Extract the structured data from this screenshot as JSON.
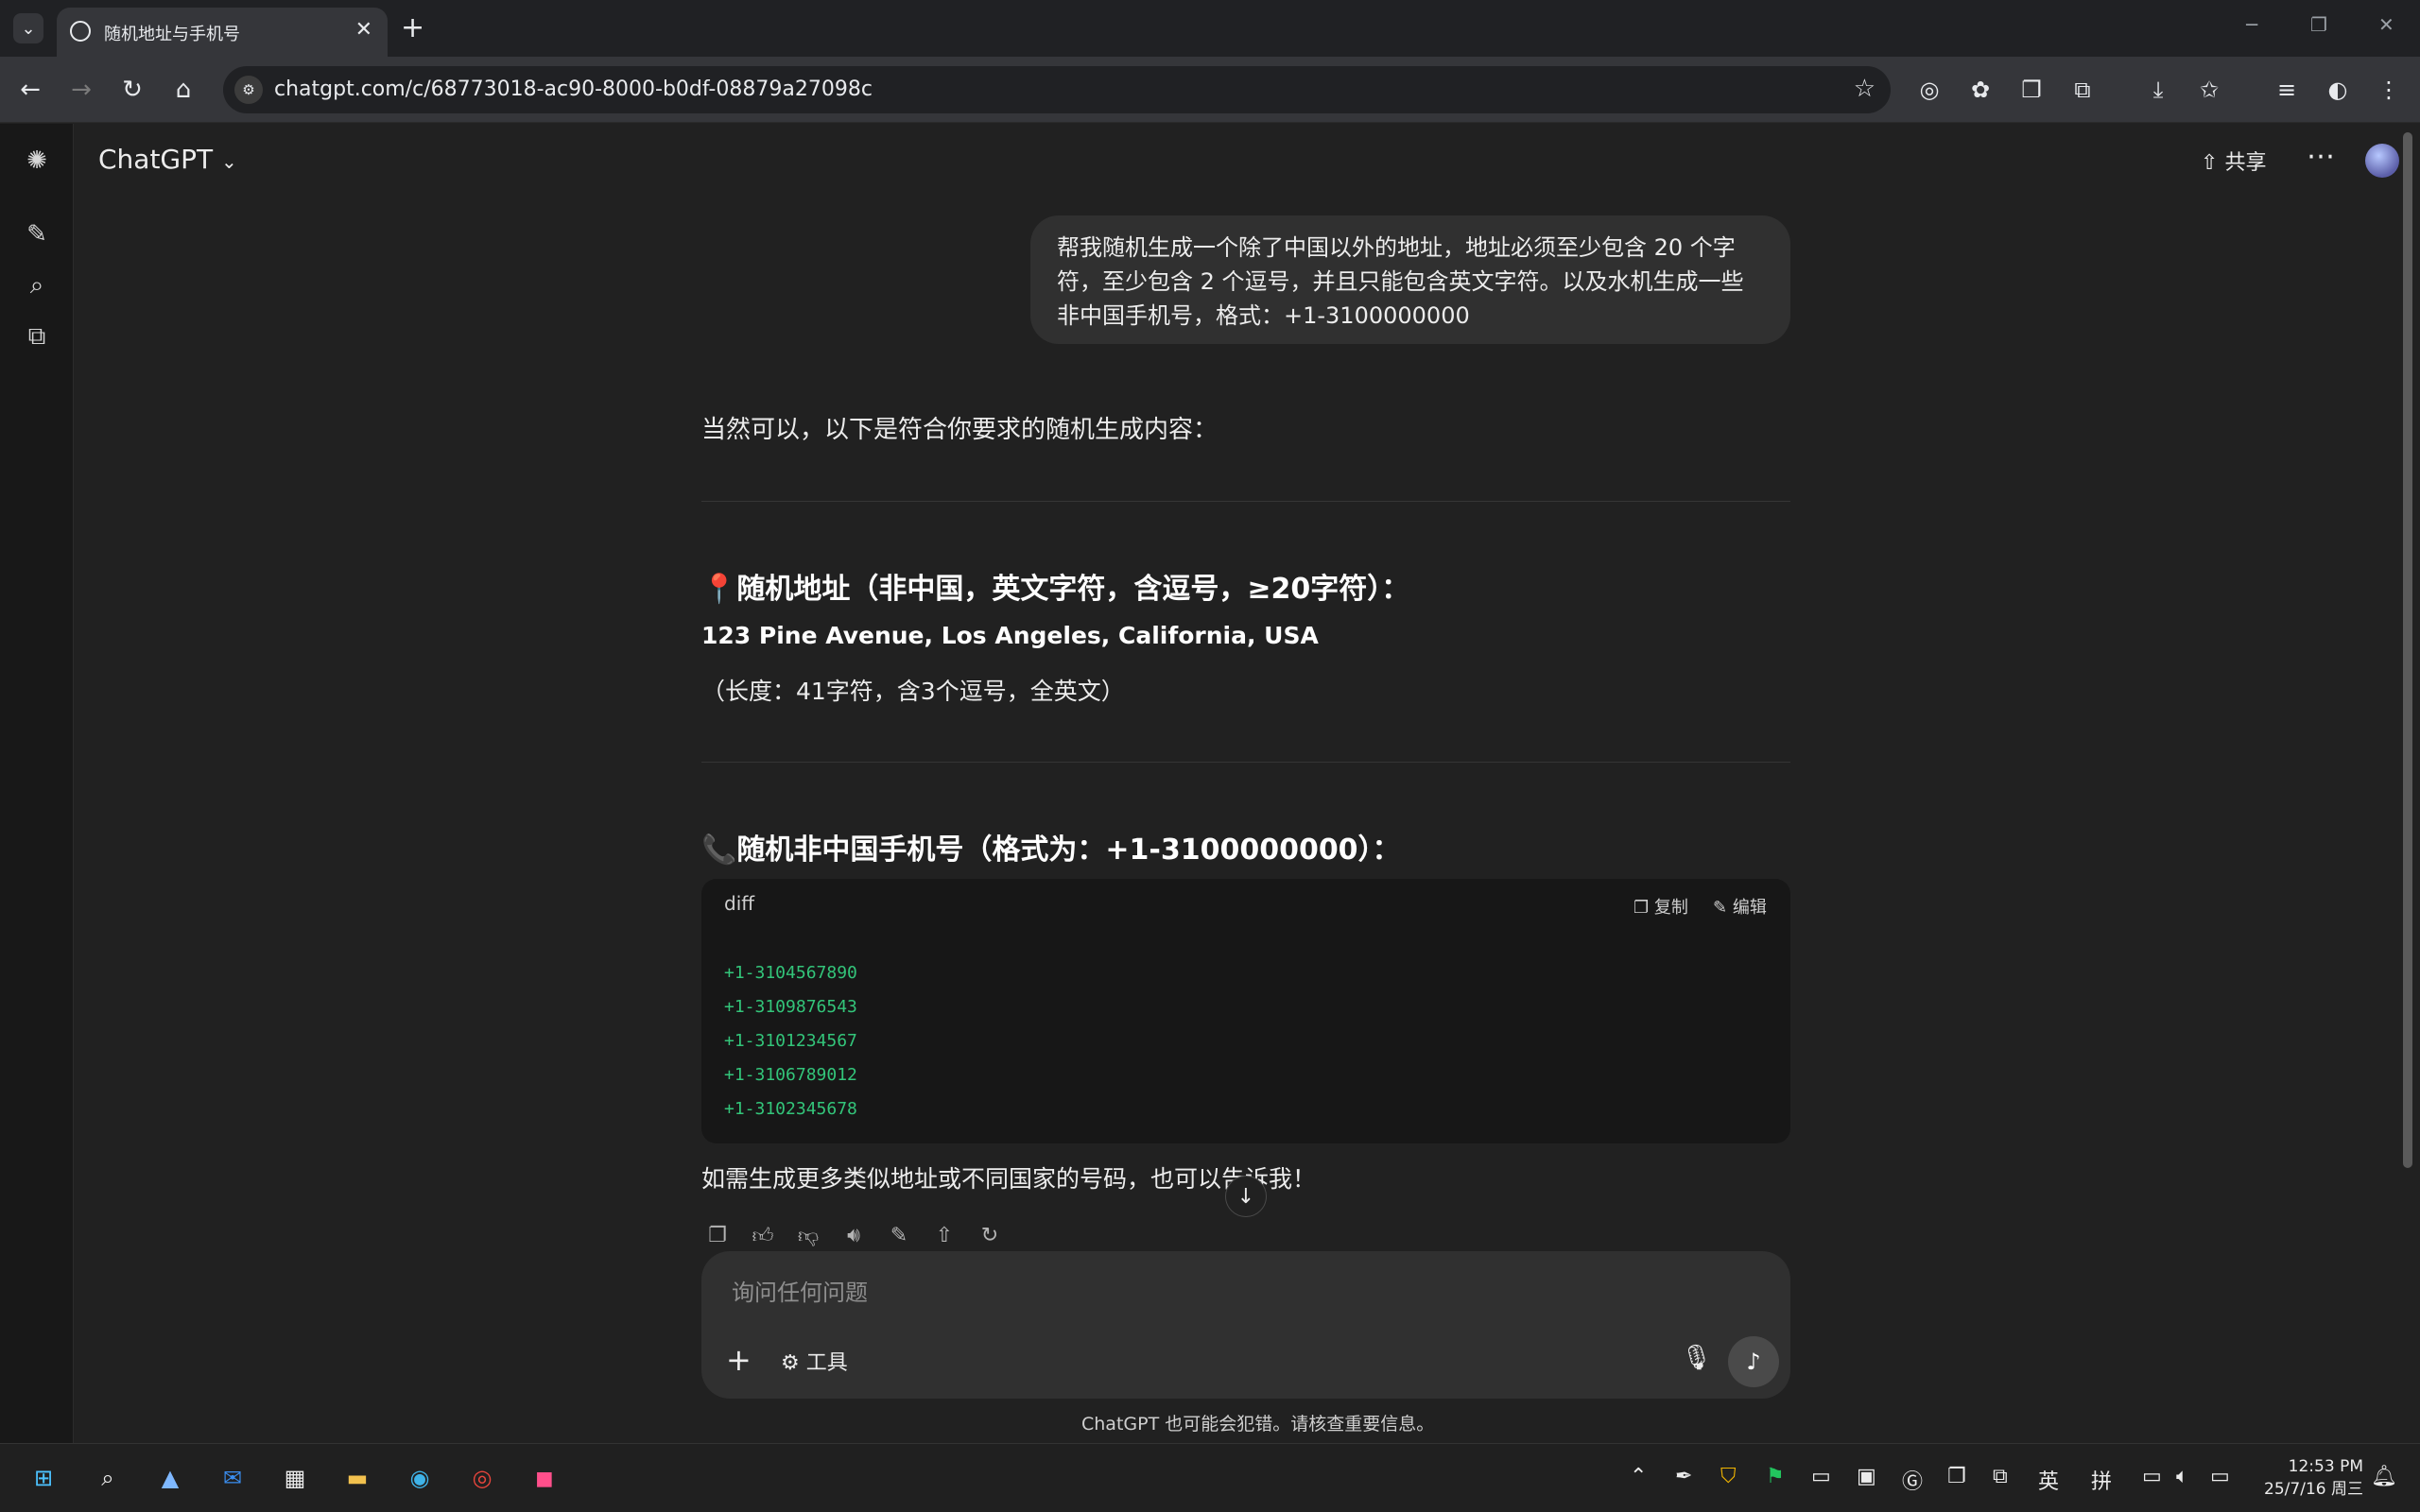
{
  "browser": {
    "tab_title": "随机地址与手机号",
    "url": "chatgpt.com/c/68773018-ac90-8000-b0df-08879a27098c"
  },
  "header": {
    "model": "ChatGPT",
    "share_label": "共享"
  },
  "conversation": {
    "user_message": "帮我随机生成一个除了中国以外的地址，地址必须至少包含 20 个字符，至少包含 2 个逗号，并且只能包含英文字符。以及水机生成一些非中国手机号，格式：+1-3100000000",
    "intro": "当然可以，以下是符合你要求的随机生成内容：",
    "section1_icon": "📍",
    "section1_title": "随机地址（非中国，英文字符，含逗号，≥20字符）：",
    "address": "123 Pine Avenue, Los Angeles, California, USA",
    "address_note": "（长度：41字符，含3个逗号，全英文）",
    "section2_icon": "📞",
    "section2_title": "随机非中国手机号（格式为：+1-3100000000）：",
    "code_lang": "diff",
    "copy_label": "复制",
    "edit_label": "编辑",
    "phones": [
      "+1-3104567890",
      "+1-3109876543",
      "+1-3101234567",
      "+1-3106789012",
      "+1-3102345678"
    ],
    "closing": "如需生成更多类似地址或不同国家的号码，也可以告诉我！"
  },
  "composer": {
    "placeholder": "询问任何问题",
    "tools_label": "工具",
    "disclaimer": "ChatGPT 也可能会犯错。请核查重要信息。"
  },
  "taskbar": {
    "ime_lang": "英",
    "ime_mode": "拼",
    "time": "12:53 PM",
    "date": "25/7/16 周三"
  }
}
